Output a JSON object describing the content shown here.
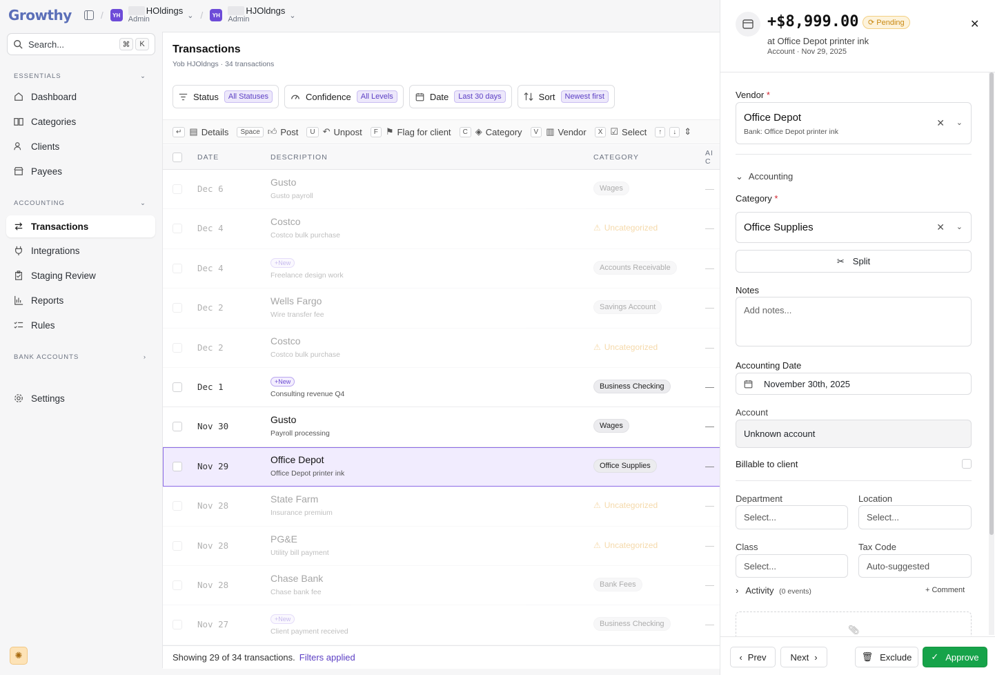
{
  "app": {
    "logo": "Growthy"
  },
  "orgs": [
    {
      "badge": "YH",
      "name": "HOldings",
      "role": "Admin"
    },
    {
      "badge": "YH",
      "name": "HJOldngs",
      "role": "Admin"
    }
  ],
  "sidebar": {
    "search_placeholder": "Search...",
    "shortcut": [
      "⌘",
      "K"
    ],
    "sections": {
      "essentials": "ESSENTIALS",
      "accounting": "ACCOUNTING",
      "bank_accounts": "BANK ACCOUNTS"
    },
    "essentials": [
      {
        "label": "Dashboard",
        "icon": "home-icon"
      },
      {
        "label": "Categories",
        "icon": "book-icon"
      },
      {
        "label": "Clients",
        "icon": "users-icon"
      },
      {
        "label": "Payees",
        "icon": "store-icon"
      }
    ],
    "accounting": [
      {
        "label": "Transactions",
        "icon": "arrows-icon",
        "active": true
      },
      {
        "label": "Integrations",
        "icon": "plug-icon"
      },
      {
        "label": "Staging Review",
        "icon": "clipboard-icon"
      },
      {
        "label": "Reports",
        "icon": "chart-icon"
      },
      {
        "label": "Rules",
        "icon": "list-icon"
      }
    ],
    "settings": "Settings"
  },
  "main": {
    "title": "Transactions",
    "subtitle": "Yob HJOldngs · 34 transactions",
    "filters": [
      {
        "label": "Status",
        "value": "All Statuses",
        "icon": "filter-icon"
      },
      {
        "label": "Confidence",
        "value": "All Levels",
        "icon": "gauge-icon"
      },
      {
        "label": "Date",
        "value": "Last 30 days",
        "icon": "calendar-icon"
      },
      {
        "label": "Sort",
        "value": "Newest first",
        "icon": "sort-icon"
      }
    ],
    "actions": [
      {
        "key": "↵",
        "label": "Details",
        "icon": "details-icon"
      },
      {
        "key": "Space",
        "label": "Post",
        "icon": "thumbs-up-icon"
      },
      {
        "key": "U",
        "label": "Unpost",
        "icon": "undo-icon"
      },
      {
        "key": "F",
        "label": "Flag for client",
        "icon": "flag-icon"
      },
      {
        "key": "C",
        "label": "Category",
        "icon": "tag-icon"
      },
      {
        "key": "V",
        "label": "Vendor",
        "icon": "building-icon"
      },
      {
        "key": "X",
        "label": "Select",
        "icon": "check-square-icon"
      }
    ],
    "columns": {
      "date": "DATE",
      "description": "DESCRIPTION",
      "category": "CATEGORY",
      "ai": "AI C"
    },
    "rows": [
      {
        "date": "Dec 6",
        "name": "Gusto",
        "sub": "Gusto payroll",
        "category": "Wages",
        "uncat": false,
        "is_new": false,
        "dim": true
      },
      {
        "date": "Dec 4",
        "name": "Costco",
        "sub": "Costco bulk purchase",
        "category": "Uncategorized",
        "uncat": true,
        "is_new": false,
        "dim": true
      },
      {
        "date": "Dec 4",
        "name": "+New",
        "sub": "Freelance design work",
        "category": "Accounts Receivable",
        "uncat": false,
        "is_new": true,
        "dim": true
      },
      {
        "date": "Dec 2",
        "name": "Wells Fargo",
        "sub": "Wire transfer fee",
        "category": "Savings Account",
        "uncat": false,
        "is_new": false,
        "dim": true
      },
      {
        "date": "Dec 2",
        "name": "Costco",
        "sub": "Costco bulk purchase",
        "category": "Uncategorized",
        "uncat": true,
        "is_new": false,
        "dim": true
      },
      {
        "date": "Dec 1",
        "name": "+New",
        "sub": "Consulting revenue Q4",
        "category": "Business Checking",
        "uncat": false,
        "is_new": true,
        "dim": false
      },
      {
        "date": "Nov 30",
        "name": "Gusto",
        "sub": "Payroll processing",
        "category": "Wages",
        "uncat": false,
        "is_new": false,
        "dim": false
      },
      {
        "date": "Nov 29",
        "name": "Office Depot",
        "sub": "Office Depot printer ink",
        "category": "Office Supplies",
        "uncat": false,
        "is_new": false,
        "dim": false,
        "selected": true
      },
      {
        "date": "Nov 28",
        "name": "State Farm",
        "sub": "Insurance premium",
        "category": "Uncategorized",
        "uncat": true,
        "is_new": false,
        "dim": true
      },
      {
        "date": "Nov 28",
        "name": "PG&E",
        "sub": "Utility bill payment",
        "category": "Uncategorized",
        "uncat": true,
        "is_new": false,
        "dim": true
      },
      {
        "date": "Nov 28",
        "name": "Chase Bank",
        "sub": "Chase bank fee",
        "category": "Bank Fees",
        "uncat": false,
        "is_new": false,
        "dim": true
      },
      {
        "date": "Nov 27",
        "name": "+New",
        "sub": "Client payment received",
        "category": "Business Checking",
        "uncat": false,
        "is_new": true,
        "dim": true
      }
    ],
    "ai_placeholder": "—",
    "footer": {
      "text": "Showing 29 of 34 transactions.",
      "link": "Filters applied"
    }
  },
  "panel": {
    "amount": "+$8,999.00",
    "status": "Pending",
    "subtitle": "at Office Depot printer ink",
    "meta": "Account · Nov 29, 2025",
    "vendor_label": "Vendor",
    "vendor_name": "Office Depot",
    "vendor_sub": "Bank: Office Depot printer ink",
    "accounting_section": "Accounting",
    "category_label": "Category",
    "category_value": "Office Supplies",
    "split": "Split",
    "notes_label": "Notes",
    "notes_placeholder": "Add notes...",
    "date_label": "Accounting Date",
    "date_value": "November 30th, 2025",
    "account_label": "Account",
    "account_value": "Unknown account",
    "billable_label": "Billable to client",
    "department_label": "Department",
    "location_label": "Location",
    "class_label": "Class",
    "taxcode_label": "Tax Code",
    "select_placeholder": "Select...",
    "taxcode_value": "Auto-suggested",
    "activity_label": "Activity",
    "activity_count": "(0 events)",
    "comment": "+ Comment",
    "prev": "Prev",
    "next": "Next",
    "exclude": "Exclude",
    "approve": "Approve",
    "colors": {
      "accent": "#6d4bd8",
      "approve": "#16a34a",
      "pending": "#c98811"
    }
  }
}
